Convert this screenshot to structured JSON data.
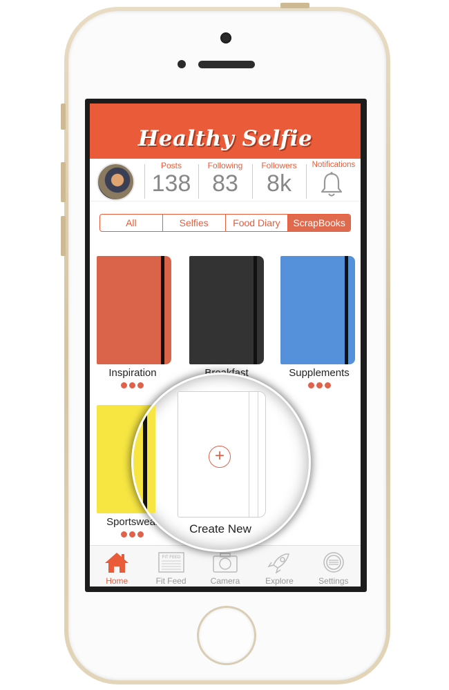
{
  "app": {
    "title": "Healthy Selfie"
  },
  "stats": [
    {
      "label": "Posts",
      "value": "138"
    },
    {
      "label": "Following",
      "value": "83"
    },
    {
      "label": "Followers",
      "value": "8k"
    }
  ],
  "notifications": {
    "label": "Notifications",
    "icon": "bell-icon"
  },
  "tabs": [
    {
      "label": "All",
      "active": false
    },
    {
      "label": "Selfies",
      "active": false
    },
    {
      "label": "Food Diary",
      "active": false
    },
    {
      "label": "ScrapBooks",
      "active": true
    }
  ],
  "scrapbooks": [
    {
      "name": "Inspiration",
      "color": "#d9644a"
    },
    {
      "name": "Breakfast",
      "color": "#333333"
    },
    {
      "name": "Supplements",
      "color": "#5590db"
    },
    {
      "name": "Sportswear",
      "color": "#f7e642"
    }
  ],
  "create_new": {
    "label": "Create New",
    "icon": "plus-circle-icon"
  },
  "tabbar": [
    {
      "label": "Home",
      "icon": "home-icon",
      "active": true
    },
    {
      "label": "Fit Feed",
      "icon": "newspaper-icon",
      "badge": "FIT FEED",
      "active": false
    },
    {
      "label": "Camera",
      "icon": "camera-icon",
      "active": false
    },
    {
      "label": "Explore",
      "icon": "rocket-icon",
      "active": false
    },
    {
      "label": "Settings",
      "icon": "gear-icon",
      "active": false
    }
  ],
  "colors": {
    "accent": "#ea5c39",
    "inactive": "#999999"
  }
}
